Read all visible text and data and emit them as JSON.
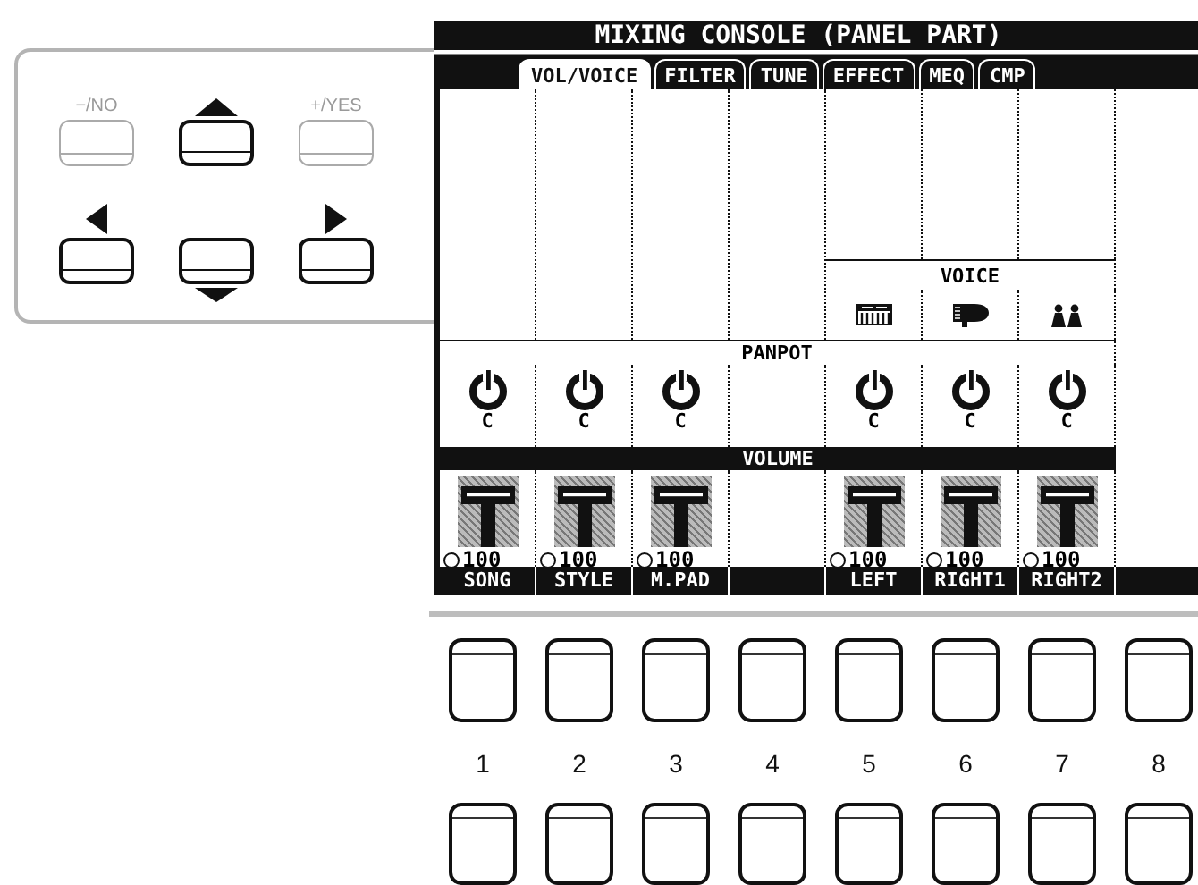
{
  "nav_buttons": [
    {
      "kind": "dec",
      "label": "−/NO",
      "disabled": true
    },
    {
      "kind": "up",
      "disabled": false
    },
    {
      "kind": "inc",
      "label": "+/YES",
      "disabled": true
    },
    {
      "kind": "left",
      "disabled": false
    },
    {
      "kind": "down",
      "disabled": false
    },
    {
      "kind": "right",
      "disabled": false
    }
  ],
  "lcd": {
    "title": "MIXING CONSOLE (PANEL PART)",
    "tabs": [
      {
        "label": "VOL/VOICE",
        "selected": true
      },
      {
        "label": "FILTER",
        "selected": false
      },
      {
        "label": "TUNE",
        "selected": false
      },
      {
        "label": "EFFECT",
        "selected": false
      },
      {
        "label": "MEQ",
        "selected": false
      },
      {
        "label": "CMP",
        "selected": false
      }
    ],
    "voice_header": "VOICE",
    "panpot_header": "PANPOT",
    "volume_header": "VOLUME",
    "channels": [
      {
        "kind": "part",
        "name": "SONG",
        "pan": "C",
        "volume": "100",
        "level": 0.8
      },
      {
        "kind": "part",
        "name": "STYLE",
        "pan": "C",
        "volume": "100",
        "level": 0.8
      },
      {
        "kind": "part",
        "name": "M.PAD",
        "pan": "C",
        "volume": "100",
        "level": 0.8
      },
      {
        "kind": "empty"
      },
      {
        "kind": "part",
        "name": "LEFT",
        "voice": {
          "kind": "keyboard"
        },
        "pan": "C",
        "volume": "100",
        "level": 0.8
      },
      {
        "kind": "part",
        "name": "RIGHT1",
        "voice": {
          "kind": "piano"
        },
        "pan": "C",
        "volume": "100",
        "level": 0.8
      },
      {
        "kind": "part",
        "name": "RIGHT2",
        "voice": {
          "kind": "choir"
        },
        "pan": "C",
        "volume": "100",
        "level": 0.8
      }
    ]
  },
  "number_buttons": [
    "1",
    "2",
    "3",
    "4",
    "5",
    "6",
    "7",
    "8"
  ]
}
